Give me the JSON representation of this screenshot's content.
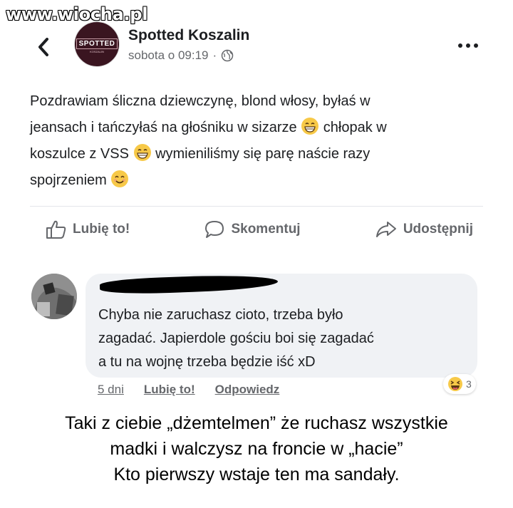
{
  "watermark": "www.wiocha.pl",
  "post": {
    "page_name": "Spotted Koszalin",
    "timestamp": "sobota o 09:19",
    "separator": "·",
    "avatar_logo": "SPOTTED",
    "avatar_sub": "KOSZALIN",
    "text_lines": [
      "Pozdrawiam śliczna dziewczynę, blond włosy, byłaś w",
      "jeansach i tańczyłaś na głośniku w sizarze",
      "chłopak w",
      "koszulce z VSS",
      "wymieniliśmy się parę naście razy",
      "spojrzeniem"
    ],
    "actions": {
      "like": "Lubię to!",
      "comment": "Skomentuj",
      "share": "Udostępnij"
    }
  },
  "comment": {
    "lines": [
      "Chyba nie zaruchasz cioto, trzeba było",
      "zagadać. Japierdole gościu boi się zagadać",
      "a tu na wojnę trzeba będzie iść xD"
    ],
    "age": "5 dni",
    "like": "Lubię to!",
    "reply": "Odpowiedz",
    "reaction_count": "3"
  },
  "caption": {
    "lines": [
      "Taki z ciebie „dżemtelmen” że ruchasz wszystkie",
      "madki i walczysz na froncie w „hacie”",
      "Kto pierwszy wstaje ten ma sandały."
    ]
  },
  "colors": {
    "text": "#1c1e21",
    "secondary": "#65676b",
    "bubble": "#f0f2f5",
    "divider": "#e4e6eb",
    "emoji": "#f7c948"
  },
  "icons": {
    "back": "chevron-left-icon",
    "more": "more-dots-icon",
    "globe": "globe-icon",
    "like": "thumbs-up-icon",
    "comment": "comment-bubble-icon",
    "share": "share-arrow-icon",
    "emoji_grin": "grinning-emoji-icon",
    "emoji_smile": "smiling-emoji-icon",
    "emoji_laugh": "laughing-emoji-icon"
  }
}
